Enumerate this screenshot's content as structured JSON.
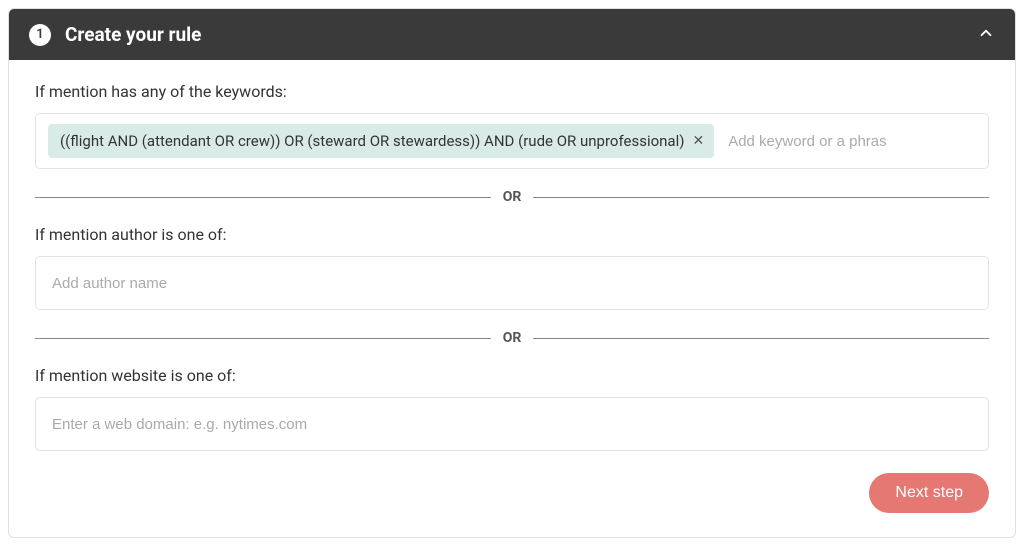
{
  "header": {
    "step_number": "1",
    "title": "Create your rule"
  },
  "sections": {
    "keywords": {
      "label": "If mention has any of the keywords:",
      "tags": [
        "((flight AND (attendant OR crew)) OR (steward OR stewardess)) AND (rude OR unprofessional)"
      ],
      "placeholder": "Add keyword or a phras"
    },
    "author": {
      "label": "If mention author is one of:",
      "placeholder": "Add author name"
    },
    "website": {
      "label": "If mention website is one of:",
      "placeholder": "Enter a web domain: e.g. nytimes.com"
    }
  },
  "divider_label": "OR",
  "footer": {
    "next_label": "Next step"
  }
}
